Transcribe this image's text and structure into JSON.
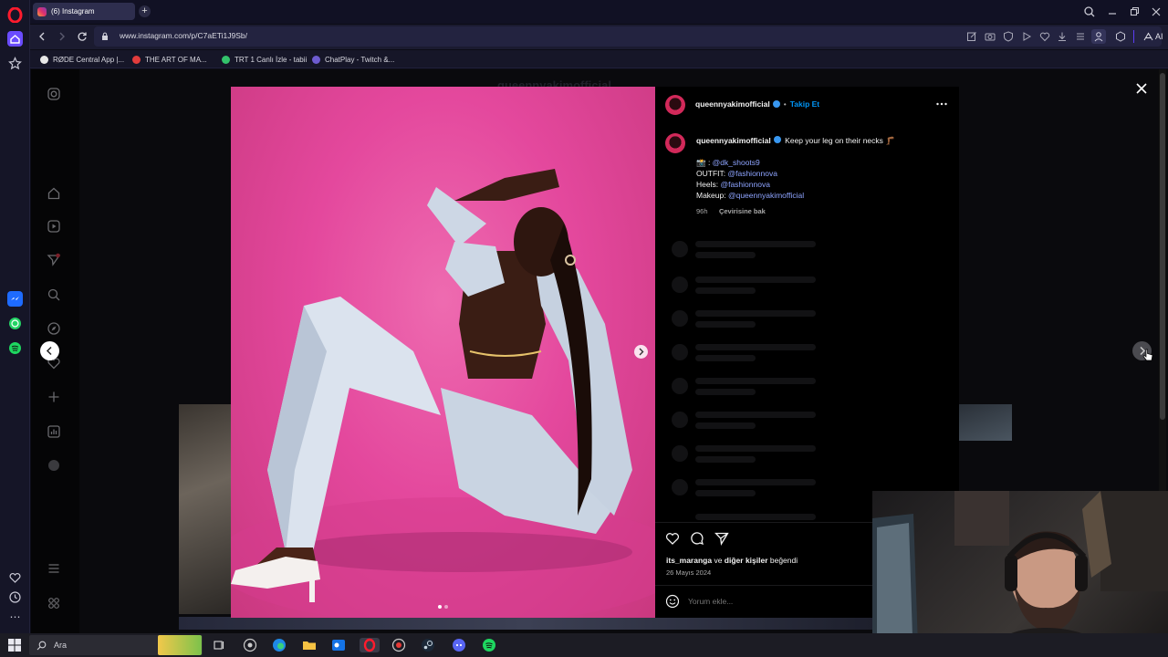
{
  "browser": {
    "tab_title": "(6) Instagram",
    "new_tab": "+",
    "url": "www.instagram.com/p/C7aETi1J9Sb/",
    "ai_label": "AI",
    "bookmarks": [
      {
        "label": "RØDE Central App |...",
        "icon_color": "#e8e8e8"
      },
      {
        "label": "THE ART OF MA...",
        "icon_color": "#e23c3c"
      },
      {
        "label": "TRT 1 Canlı İzle - tabii",
        "icon_color": "#33c26b"
      },
      {
        "label": "ChatPlay - Twitch &...",
        "icon_color": "#6d5bd0"
      }
    ]
  },
  "post": {
    "username": "queennyakimofficial",
    "follow_label": "Takip Et",
    "separator": "•",
    "more_icon": "more-horizontal-icon",
    "caption_text": "Keep your leg on their necks 🦵🏾",
    "credits": [
      {
        "prefix": "📸 : ",
        "mention": "@dk_shoots9"
      },
      {
        "prefix": "OUTFIT: ",
        "mention": "@fashionnova"
      },
      {
        "prefix": "Heels: ",
        "mention": "@fashionnova"
      },
      {
        "prefix": "Makeup: ",
        "mention": "@queennyakimofficial"
      }
    ],
    "time_ago": "96h",
    "see_translation": "Çevirisine bak",
    "likes_user": "its_maranga",
    "likes_conj": " ve ",
    "likes_others": "diğer kişiler",
    "likes_suffix": " beğendi",
    "date": "26 Mayıs 2024",
    "comment_placeholder": "Yorum ekle...",
    "image_count": 2,
    "active_image": 1
  },
  "taskbar": {
    "search_label": "Ara"
  },
  "colors": {
    "accent_link": "#8ea4ff",
    "follow_blue": "#0095f6",
    "photo_bg": "#e4489d"
  }
}
